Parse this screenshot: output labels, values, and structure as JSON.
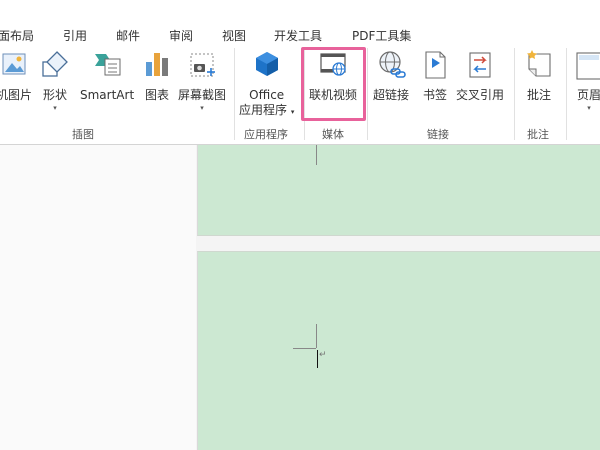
{
  "tabs": [
    "面布局",
    "引用",
    "邮件",
    "审阅",
    "视图",
    "开发工具",
    "PDF工具集"
  ],
  "groups": {
    "illustrations": {
      "label": "插图",
      "buttons": [
        {
          "label": "机图片",
          "icon": "online-picture-icon"
        },
        {
          "label": "形状",
          "icon": "shapes-icon",
          "dropdown": "▾"
        },
        {
          "label": "SmartArt",
          "icon": "smartart-icon"
        },
        {
          "label": "图表",
          "icon": "chart-icon"
        },
        {
          "label": "屏幕截图",
          "icon": "screenshot-icon",
          "dropdown": "▾"
        }
      ]
    },
    "apps": {
      "label": "应用程序",
      "buttons": [
        {
          "label": "Office",
          "label2": "应用程序",
          "icon": "office-apps-icon",
          "dropdown": "▾"
        }
      ]
    },
    "media": {
      "label": "媒体",
      "buttons": [
        {
          "label": "联机视频",
          "icon": "online-video-icon"
        }
      ]
    },
    "links": {
      "label": "链接",
      "buttons": [
        {
          "label": "超链接",
          "icon": "hyperlink-icon"
        },
        {
          "label": "书签",
          "icon": "bookmark-icon"
        },
        {
          "label": "交叉引用",
          "icon": "cross-reference-icon"
        }
      ]
    },
    "comments": {
      "label": "批注",
      "buttons": [
        {
          "label": "批注",
          "icon": "comment-icon"
        }
      ]
    },
    "header": {
      "buttons": [
        {
          "label": "页眉",
          "icon": "header-icon",
          "dropdown": "▾"
        }
      ]
    }
  },
  "document": {
    "paragraph_mark": "↵"
  },
  "colors": {
    "page_background": "#cce8d2",
    "highlight": "#e8629b",
    "office_blue": "#1e73c8"
  }
}
